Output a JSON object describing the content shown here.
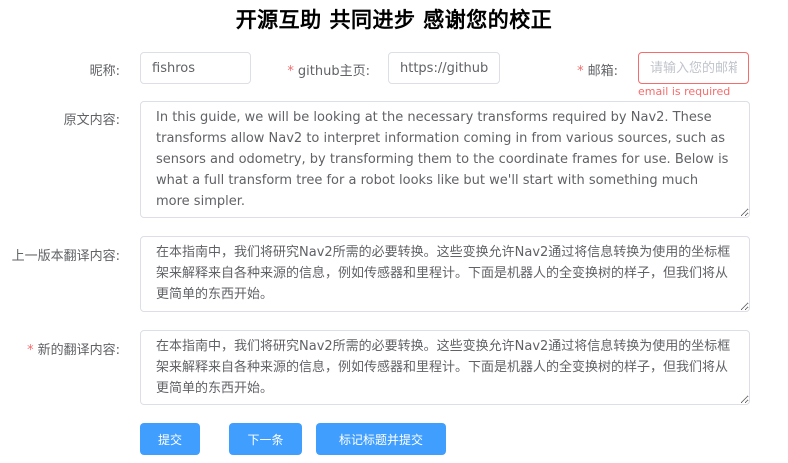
{
  "page": {
    "title": "开源互助 共同进步 感谢您的校正"
  },
  "form": {
    "nickname": {
      "label": "昵称:",
      "value": "fishros"
    },
    "github": {
      "required_mark": "*",
      "label": "github主页:",
      "value": "https://github.c"
    },
    "email": {
      "required_mark": "*",
      "label": "邮箱:",
      "placeholder": "请输入您的邮箱",
      "error": "email is required"
    },
    "original": {
      "label": "原文内容:",
      "value": "In this guide, we will be looking at the necessary transforms required by Nav2. These transforms allow Nav2 to interpret information coming in from various sources, such as sensors and odometry, by transforming them to the coordinate frames for use. Below is what a full transform tree for a robot looks like but we'll start with something much more simpler."
    },
    "previous": {
      "label": "上一版本翻译内容:",
      "value": "在本指南中，我们将研究Nav2所需的必要转换。这些变换允许Nav2通过将信息转换为使用的坐标框架来解释来自各种来源的信息，例如传感器和里程计。下面是机器人的全变换树的样子，但我们将从更简单的东西开始。"
    },
    "new": {
      "required_mark": "*",
      "label": "新的翻译内容:",
      "value": "在本指南中，我们将研究Nav2所需的必要转换。这些变换允许Nav2通过将信息转换为使用的坐标框架来解释来自各种来源的信息，例如传感器和里程计。下面是机器人的全变换树的样子，但我们将从更简单的东西开始。"
    }
  },
  "buttons": {
    "submit": "提交",
    "next": "下一条",
    "mark_submit": "标记标题并提交"
  },
  "colors": {
    "primary": "#409eff",
    "error": "#f56c6c",
    "border": "#dcdfe6",
    "text": "#606266"
  }
}
